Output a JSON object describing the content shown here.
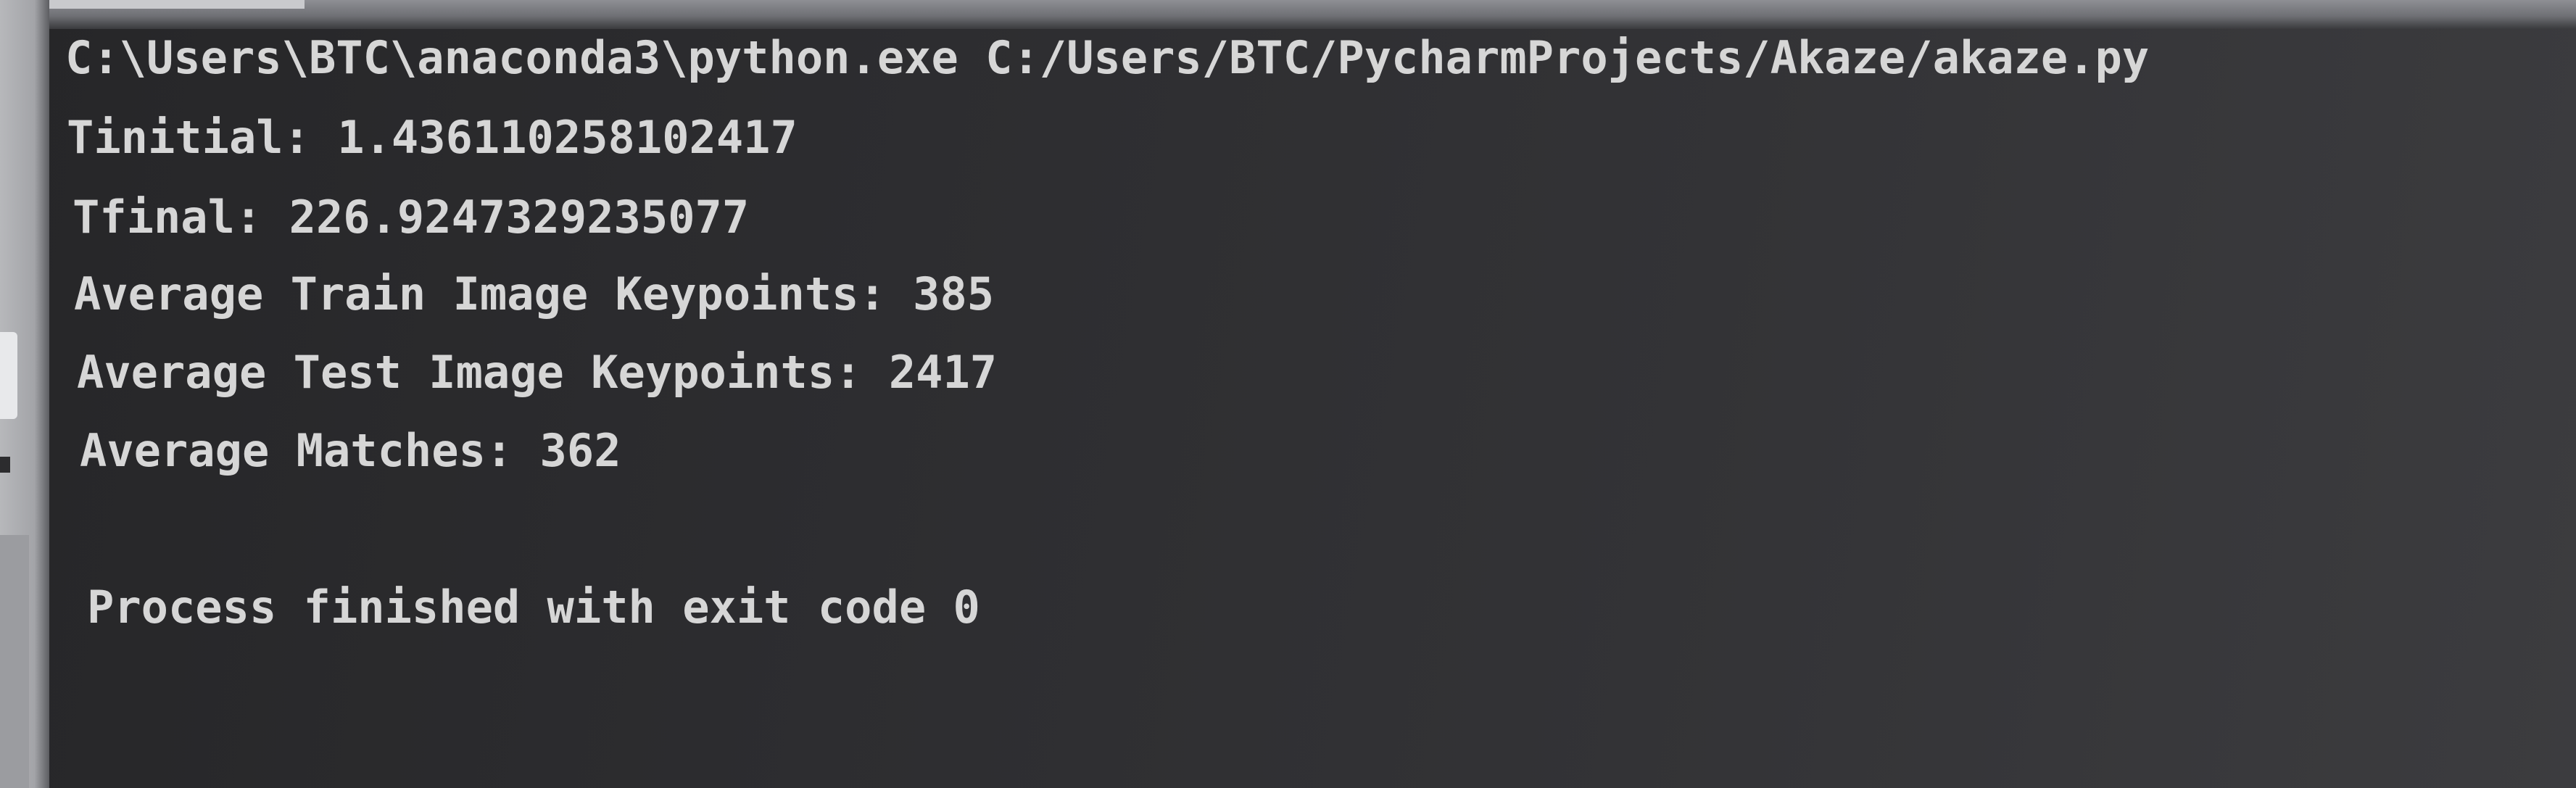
{
  "console": {
    "command": "C:\\Users\\BTC\\anaconda3\\python.exe C:/Users/BTC/PycharmProjects/Akaze/akaze.py",
    "lines": [
      "Tinitial: 1.436110258102417",
      "Tfinal: 226.9247329235077",
      "Average Train Image Keypoints: 385",
      "Average Test Image Keypoints: 2417",
      "Average Matches: 362"
    ],
    "exit_message": "Process finished with exit code 0"
  },
  "colors": {
    "background": "#2d2d30",
    "text": "#d6d6d6"
  }
}
